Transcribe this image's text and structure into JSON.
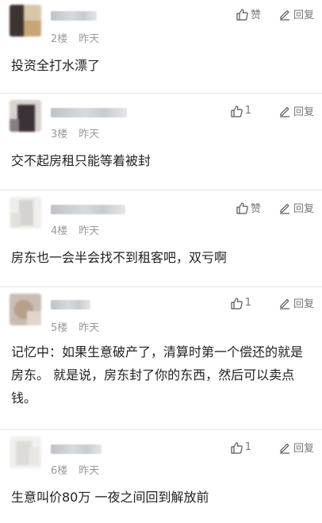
{
  "comments": [
    {
      "floor": "2楼",
      "time": "昨天",
      "like": "赞",
      "reply": "回复",
      "text": "投资全打水漂了"
    },
    {
      "floor": "3楼",
      "time": "昨天",
      "like": "1",
      "reply": "回复",
      "text": "交不起房租只能等着被封"
    },
    {
      "floor": "4楼",
      "time": "昨天",
      "like": "赞",
      "reply": "回复",
      "text": "房东也一会半会找不到租客吧，双亏啊"
    },
    {
      "floor": "5楼",
      "time": "昨天",
      "like": "1",
      "reply": "回复",
      "text": "记忆中：如果生意破产了，清算时第一个偿还的就是房东。 就是说，房东封了你的东西，然后可以卖点钱。"
    },
    {
      "floor": "6楼",
      "time": "昨天",
      "like": "1",
      "reply": "回复",
      "text": "生意叫价80万 一夜之间回到解放前"
    }
  ],
  "icons": {
    "like": "thumbs-up-icon",
    "reply": "pencil-icon"
  },
  "colors": {
    "meta": "#9a9a9a",
    "action": "#777777",
    "divider": "#e6e6e6"
  }
}
